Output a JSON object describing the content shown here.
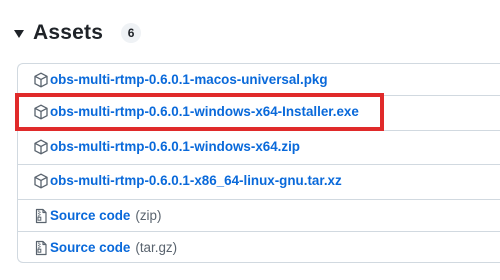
{
  "assets": {
    "title": "Assets",
    "count": "6"
  },
  "files": [
    {
      "name": "obs-multi-rtmp-0.6.0.1-macos-universal.pkg",
      "icon": "package-icon"
    },
    {
      "name": "obs-multi-rtmp-0.6.0.1-windows-x64-Installer.exe",
      "icon": "package-icon"
    },
    {
      "name": "obs-multi-rtmp-0.6.0.1-windows-x64.zip",
      "icon": "package-icon"
    },
    {
      "name": "obs-multi-rtmp-0.6.0.1-x86_64-linux-gnu.tar.xz",
      "icon": "package-icon"
    }
  ],
  "source": [
    {
      "label": "Source code",
      "format": "(zip)",
      "icon": "file-zip-icon"
    },
    {
      "label": "Source code",
      "format": "(tar.gz)",
      "icon": "file-zip-icon"
    }
  ],
  "colors": {
    "link": "#0969da",
    "highlight": "#e02a2a",
    "border": "#d1d9e0"
  }
}
